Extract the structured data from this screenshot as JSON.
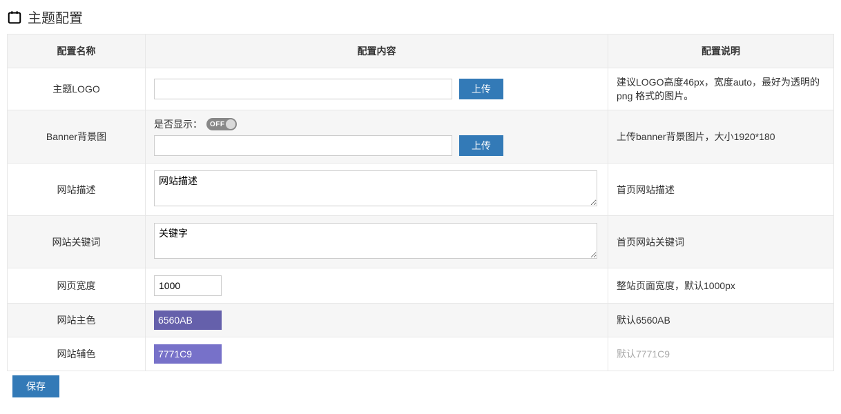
{
  "header": {
    "title": "主题配置"
  },
  "table": {
    "headers": {
      "name": "配置名称",
      "content": "配置内容",
      "desc": "配置说明"
    }
  },
  "rows": {
    "logo": {
      "name": "主题LOGO",
      "value": "",
      "upload": "上传",
      "desc": "建议LOGO高度46px，宽度auto，最好为透明的 png 格式的图片。"
    },
    "banner": {
      "name": "Banner背景图",
      "toggle_label": "是否显示：",
      "toggle_text": "OFF",
      "value": "",
      "upload": "上传",
      "desc": "上传banner背景图片，大小1920*180"
    },
    "site_desc": {
      "name": "网站描述",
      "value": "网站描述",
      "desc": "首页网站描述"
    },
    "site_keywords": {
      "name": "网站关键词",
      "value": "关键字",
      "desc": "首页网站关键词"
    },
    "page_width": {
      "name": "网页宽度",
      "value": "1000",
      "desc": "整站页面宽度，默认1000px"
    },
    "main_color": {
      "name": "网站主色",
      "value": "6560AB",
      "desc": "默认6560AB"
    },
    "aux_color": {
      "name": "网站辅色",
      "value": "7771C9",
      "desc": "默认7771C9"
    }
  },
  "save_label": "保存"
}
